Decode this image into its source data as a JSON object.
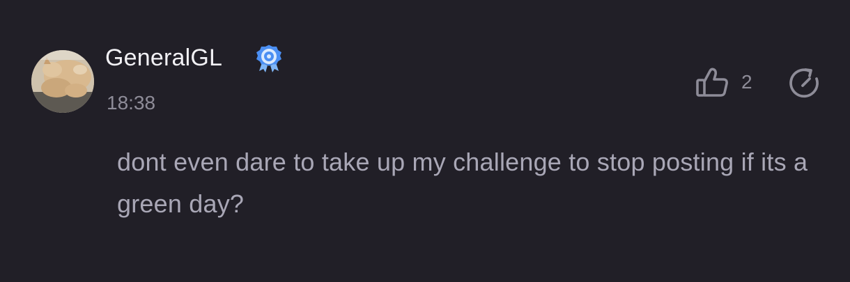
{
  "comment": {
    "author": {
      "name": "GeneralGL",
      "avatar": "cat-photo-avatar",
      "badge": "verified-badge-icon"
    },
    "timestamp": "18:38",
    "text": "dont even dare to take up my challenge to stop posting if its a green day?",
    "actions": {
      "like_icon": "thumbs-up-icon",
      "like_count": "2",
      "refresh_icon": "refresh-icon"
    }
  },
  "colors": {
    "background": "#211f27",
    "username": "#f2f1f5",
    "muted": "#8e8c98",
    "body_text": "#a9a7b6",
    "badge_blue": "#4b8ff3"
  }
}
